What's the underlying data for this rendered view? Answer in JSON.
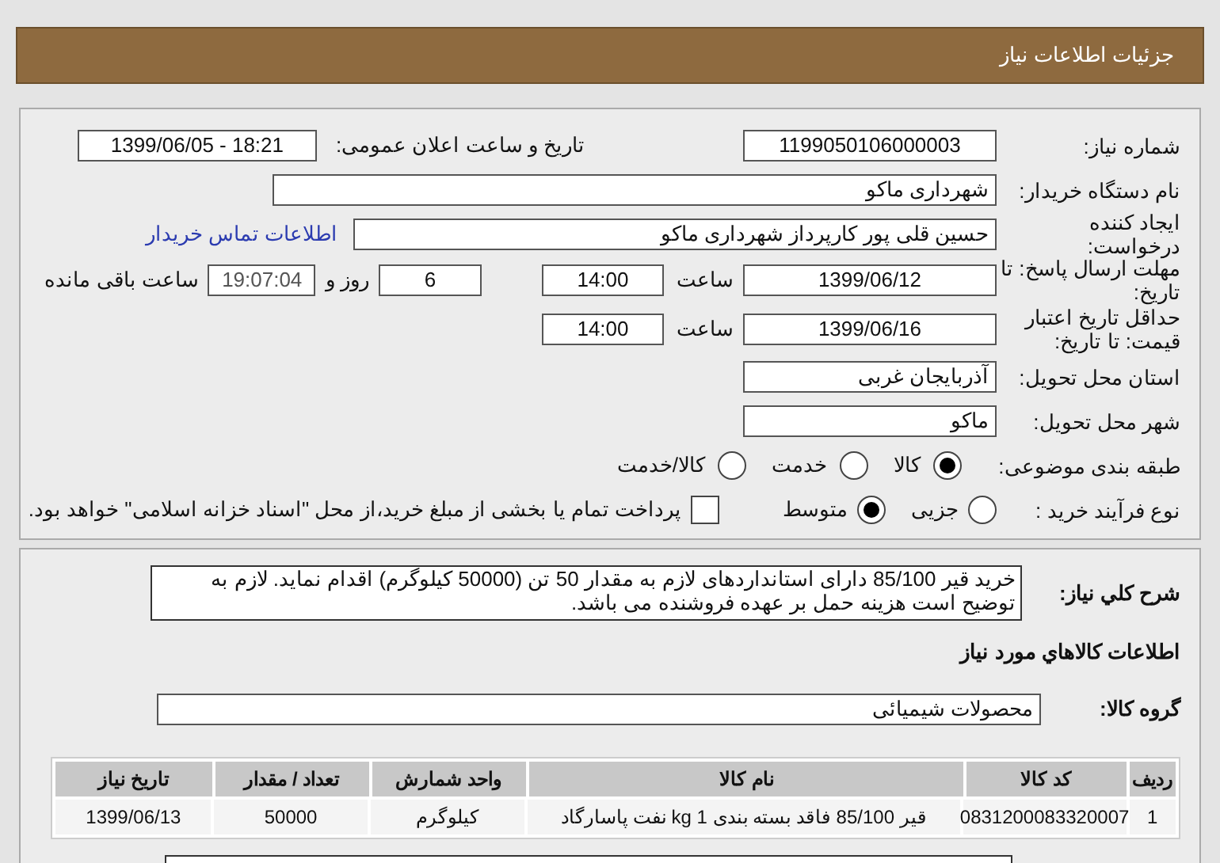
{
  "header": {
    "title": "جزئیات اطلاعات نیاز"
  },
  "need_number": {
    "label": "شماره نیاز:",
    "value": "1199050106000003"
  },
  "announce": {
    "label": "تاریخ و ساعت اعلان عمومی:",
    "value": "1399/06/05 - 18:21"
  },
  "buyer_org": {
    "label": "نام دستگاه خریدار:",
    "value": "شهرداری ماکو"
  },
  "requester": {
    "label": "ایجاد کننده درخواست:",
    "value": "حسین قلی پور کارپرداز شهرداری ماکو",
    "contact_link": "اطلاعات تماس خریدار"
  },
  "response_deadline": {
    "label": "مهلت ارسال پاسخ: تا تاریخ:",
    "date": "1399/06/12",
    "time_label": "ساعت",
    "time": "14:00",
    "days": "6",
    "days_label": "روز و",
    "remaining": "19:07:04",
    "remaining_label": "ساعت باقی مانده"
  },
  "price_validity": {
    "label": "حداقل تاریخ اعتبار قیمت: تا تاریخ:",
    "date": "1399/06/16",
    "time_label": "ساعت",
    "time": "14:00"
  },
  "province": {
    "label": "استان محل تحویل:",
    "value": "آذربایجان غربی"
  },
  "city": {
    "label": "شهر محل تحویل:",
    "value": "ماکو"
  },
  "category": {
    "label": "طبقه بندی موضوعی:",
    "options": [
      {
        "label": "کالا",
        "selected": true
      },
      {
        "label": "خدمت",
        "selected": false
      },
      {
        "label": "کالا/خدمت",
        "selected": false
      }
    ]
  },
  "process": {
    "label": "نوع فرآیند خرید :",
    "options": [
      {
        "label": "جزیی",
        "selected": false
      },
      {
        "label": "متوسط",
        "selected": true
      }
    ],
    "payment": {
      "checked": false,
      "label": "پرداخت تمام یا بخشی از مبلغ خرید،از محل \"اسناد خزانه اسلامی\" خواهد بود."
    }
  },
  "description": {
    "label": "شرح کلي نیاز:",
    "value": "خرید قیر 85/100 دارای استانداردهای لازم به مقدار 50 تن (50000 کیلوگرم) اقدام نماید. لازم به توضیح است هزینه حمل بر عهده فروشنده می باشد."
  },
  "goods_title": "اطلاعات کالاهاي مورد نیاز",
  "goods_group": {
    "label": "گروه کالا:",
    "value": "محصولات شیمیائی"
  },
  "table": {
    "columns": [
      "ردیف",
      "کد کالا",
      "نام کالا",
      "واحد شمارش",
      "تعداد / مقدار",
      "تاریخ نیاز"
    ],
    "rows": [
      [
        "1",
        "0831200083320007",
        "قیر 85/100 فاقد بسته بندی 1 kg نفت پاسارگاد",
        "کیلوگرم",
        "50000",
        "1399/06/13"
      ]
    ]
  }
}
